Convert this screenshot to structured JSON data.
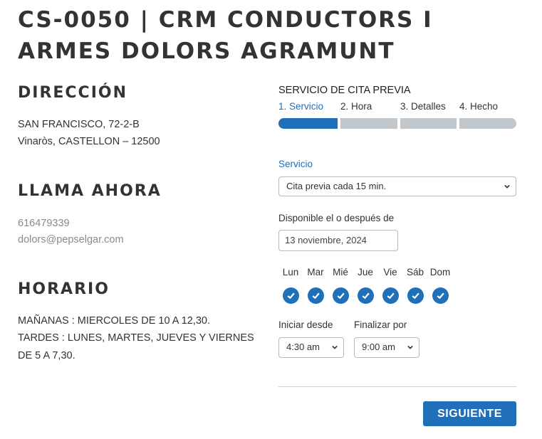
{
  "page": {
    "title": "CS-0050 | CRM CONDUCTORS I ARMES DOLORS AGRAMUNT"
  },
  "address": {
    "heading": "DIRECCIÓN",
    "line1": "SAN FRANCISCO, 72-2-B",
    "line2": "Vinaròs, CASTELLON – 12500"
  },
  "contact": {
    "heading": "LLAMA AHORA",
    "phone": "616479339",
    "email": "dolors@pepselgar.com"
  },
  "schedule": {
    "heading": "HORARIO",
    "line1": "MAÑANAS : MIERCOLES DE 10 A 12,30.",
    "line2": "TARDES : LUNES, MARTES, JUEVES Y VIERNES",
    "line3": "DE 5 A 7,30."
  },
  "booking": {
    "title": "SERVICIO DE CITA PREVIA",
    "steps": [
      {
        "label": "1. Servicio",
        "active": true
      },
      {
        "label": "2. Hora",
        "active": false
      },
      {
        "label": "3. Detalles",
        "active": false
      },
      {
        "label": "4. Hecho",
        "active": false
      }
    ],
    "service_label": "Servicio",
    "service_value": "Cita previa cada 15 min.",
    "available_label": "Disponible el o después de",
    "date_value": "13 noviembre, 2024",
    "days": [
      {
        "label": "Lun",
        "checked": true
      },
      {
        "label": "Mar",
        "checked": true
      },
      {
        "label": "Mié",
        "checked": true
      },
      {
        "label": "Jue",
        "checked": true
      },
      {
        "label": "Vie",
        "checked": true
      },
      {
        "label": "Sáb",
        "checked": true
      },
      {
        "label": "Dom",
        "checked": true
      }
    ],
    "start_label": "Iniciar desde",
    "start_value": "4:30 am",
    "end_label": "Finalizar por",
    "end_value": "9:00 am",
    "next_label": "SIGUIENTE"
  },
  "colors": {
    "accent": "#1f6fb9",
    "inactive_step": "#c2c7cb",
    "muted_text": "#8a8a8a"
  }
}
